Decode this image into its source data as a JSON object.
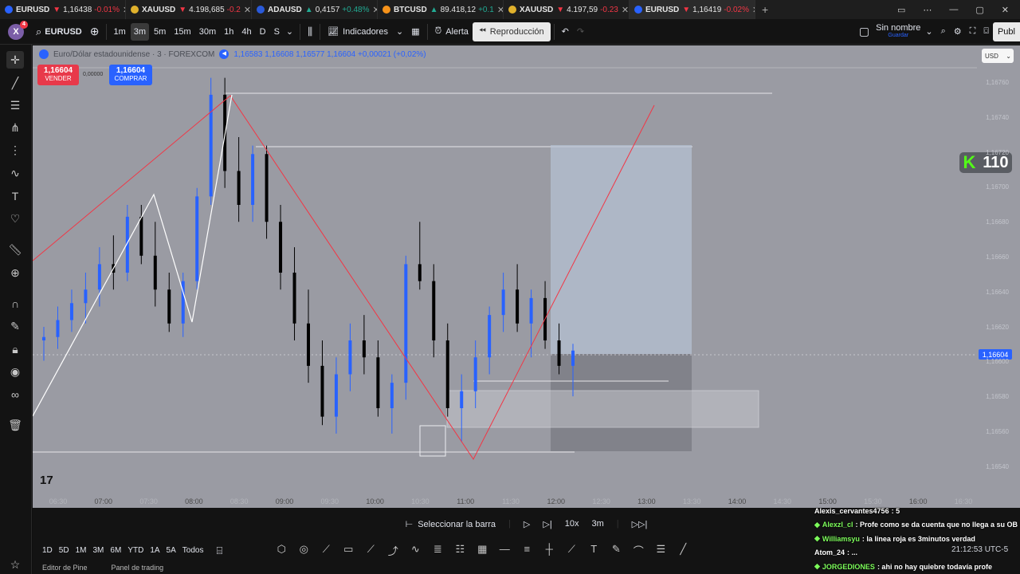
{
  "browser": {
    "tabs": [
      {
        "symbol": "EURUSD",
        "arrow": "▼",
        "price": "1,16438",
        "change": "-0.01%",
        "dir": "down",
        "coin_color": "#2962ff"
      },
      {
        "symbol": "XAUUSD",
        "arrow": "▼",
        "price": "4.198,685",
        "change": "-0.2",
        "dir": "down",
        "coin_color": "#e0b12c"
      },
      {
        "symbol": "ADAUSD",
        "arrow": "▲",
        "price": "0,4157",
        "change": "+0.48%",
        "dir": "up",
        "coin_color": "#2a5ada"
      },
      {
        "symbol": "BTCUSD",
        "arrow": "▲",
        "price": "89.418,12",
        "change": "+0.1",
        "dir": "up",
        "coin_color": "#f7931a"
      },
      {
        "symbol": "XAUUSD",
        "arrow": "▼",
        "price": "4.197,59",
        "change": "-0.23",
        "dir": "down",
        "coin_color": "#e0b12c"
      },
      {
        "symbol": "EURUSD",
        "arrow": "▼",
        "price": "1,16419",
        "change": "-0.02%",
        "dir": "down",
        "coin_color": "#2962ff",
        "active": true
      }
    ],
    "new_tab": "+"
  },
  "toolbar": {
    "logo_letter": "X",
    "logo_badge": "4",
    "symbol": "EURUSD",
    "intervals": [
      "1m",
      "3m",
      "5m",
      "15m",
      "30m",
      "1h",
      "4h",
      "D",
      "S"
    ],
    "active_interval": "3m",
    "indicators": "Indicadores",
    "alert": "Alerta",
    "replay": "Reproducción",
    "layout_name": "Sin nombre",
    "layout_sub": "Guardar",
    "publish": "Publ"
  },
  "chart": {
    "legend_title": "Euro/Dólar estadounidense · 3 · FOREXCOM",
    "ohlc": "1,16583  1,16608  1,16577  1,16604  +0,00021 (+0,02%)",
    "sell_price": "1,16604",
    "sell_label": "VENDER",
    "spread": "0,00000",
    "buy_price": "1,16604",
    "buy_label": "COMPRAR",
    "currency": "USD",
    "kick_count": "110",
    "tv_logo": "17",
    "last_price": "1,16604",
    "y_labels": [
      "1,16760",
      "1,16740",
      "1,16720",
      "1,16700",
      "1,16680",
      "1,16660",
      "1,16640",
      "1,16620",
      "1,16600",
      "1,16580",
      "1,16560",
      "1,16540"
    ],
    "x_labels": [
      "06:30",
      "07:00",
      "07:30",
      "08:00",
      "08:30",
      "09:00",
      "09:30",
      "10:00",
      "10:30",
      "11:00",
      "11:30",
      "12:00",
      "12:30",
      "13:00",
      "13:30",
      "14:00",
      "14:30",
      "15:00",
      "15:30",
      "16:00",
      "16:30"
    ],
    "colors": {
      "bull": "#2962ff",
      "bear": "#000000",
      "zigzag_red": "#f23645",
      "zigzag_white": "#ffffff",
      "background": "#9a9ba3"
    }
  },
  "chart_data": {
    "type": "candlestick",
    "title": "Euro/Dólar estadounidense · 3 · FOREXCOM",
    "xlabel": "",
    "ylabel": "",
    "ylim": [
      1.1653,
      1.1677
    ],
    "note": "approximate candle high/low/open/close values read from the chart",
    "candles": [
      {
        "o": 1.1661,
        "h": 1.16618,
        "l": 1.16598,
        "c": 1.16612
      },
      {
        "o": 1.16612,
        "h": 1.1663,
        "l": 1.16605,
        "c": 1.16622
      },
      {
        "o": 1.16622,
        "h": 1.1664,
        "l": 1.16615,
        "c": 1.16632
      },
      {
        "o": 1.16632,
        "h": 1.1665,
        "l": 1.1662,
        "c": 1.1664
      },
      {
        "o": 1.1664,
        "h": 1.16665,
        "l": 1.1663,
        "c": 1.16655
      },
      {
        "o": 1.16655,
        "h": 1.16672,
        "l": 1.1664,
        "c": 1.1665
      },
      {
        "o": 1.1665,
        "h": 1.1669,
        "l": 1.16645,
        "c": 1.16683
      },
      {
        "o": 1.16683,
        "h": 1.1669,
        "l": 1.16655,
        "c": 1.1666
      },
      {
        "o": 1.1666,
        "h": 1.1668,
        "l": 1.1663,
        "c": 1.1664
      },
      {
        "o": 1.1664,
        "h": 1.1665,
        "l": 1.16615,
        "c": 1.1662
      },
      {
        "o": 1.1662,
        "h": 1.1665,
        "l": 1.16612,
        "c": 1.16645
      },
      {
        "o": 1.16645,
        "h": 1.167,
        "l": 1.1664,
        "c": 1.16695
      },
      {
        "o": 1.16695,
        "h": 1.16765,
        "l": 1.1669,
        "c": 1.16755
      },
      {
        "o": 1.16755,
        "h": 1.16765,
        "l": 1.167,
        "c": 1.1671
      },
      {
        "o": 1.1671,
        "h": 1.1673,
        "l": 1.1668,
        "c": 1.1669
      },
      {
        "o": 1.1669,
        "h": 1.16725,
        "l": 1.1668,
        "c": 1.1672
      },
      {
        "o": 1.1672,
        "h": 1.16725,
        "l": 1.1667,
        "c": 1.1668
      },
      {
        "o": 1.1668,
        "h": 1.1669,
        "l": 1.1664,
        "c": 1.1665
      },
      {
        "o": 1.1665,
        "h": 1.16665,
        "l": 1.1661,
        "c": 1.1662
      },
      {
        "o": 1.1662,
        "h": 1.1664,
        "l": 1.16585,
        "c": 1.16595
      },
      {
        "o": 1.16595,
        "h": 1.1661,
        "l": 1.1656,
        "c": 1.16565
      },
      {
        "o": 1.16565,
        "h": 1.166,
        "l": 1.16555,
        "c": 1.1659
      },
      {
        "o": 1.1659,
        "h": 1.1662,
        "l": 1.1658,
        "c": 1.1661
      },
      {
        "o": 1.1661,
        "h": 1.16625,
        "l": 1.1659,
        "c": 1.166
      },
      {
        "o": 1.166,
        "h": 1.1661,
        "l": 1.16565,
        "c": 1.1657
      },
      {
        "o": 1.1657,
        "h": 1.1659,
        "l": 1.16555,
        "c": 1.16585
      },
      {
        "o": 1.16585,
        "h": 1.1666,
        "l": 1.16575,
        "c": 1.16655
      },
      {
        "o": 1.16655,
        "h": 1.1668,
        "l": 1.1664,
        "c": 1.16645
      },
      {
        "o": 1.16645,
        "h": 1.16655,
        "l": 1.166,
        "c": 1.1661
      },
      {
        "o": 1.1661,
        "h": 1.1662,
        "l": 1.16565,
        "c": 1.1657
      },
      {
        "o": 1.1657,
        "h": 1.1659,
        "l": 1.1655,
        "c": 1.1658
      },
      {
        "o": 1.1658,
        "h": 1.1661,
        "l": 1.1657,
        "c": 1.166
      },
      {
        "o": 1.166,
        "h": 1.1663,
        "l": 1.1659,
        "c": 1.16625
      },
      {
        "o": 1.16625,
        "h": 1.1665,
        "l": 1.16615,
        "c": 1.1664
      },
      {
        "o": 1.1664,
        "h": 1.16655,
        "l": 1.16615,
        "c": 1.1662
      },
      {
        "o": 1.1662,
        "h": 1.1664,
        "l": 1.166,
        "c": 1.16635
      },
      {
        "o": 1.16635,
        "h": 1.16645,
        "l": 1.16605,
        "c": 1.1661
      },
      {
        "o": 1.1661,
        "h": 1.1662,
        "l": 1.1659,
        "c": 1.16595
      },
      {
        "o": 1.16595,
        "h": 1.16608,
        "l": 1.16577,
        "c": 1.16604
      }
    ]
  },
  "replay": {
    "select_bar": "Seleccionar la barra",
    "speed": "10x",
    "interval": "3m"
  },
  "bottom": {
    "ranges": [
      "1D",
      "5D",
      "1M",
      "3M",
      "6M",
      "YTD",
      "1A",
      "5A",
      "Todos"
    ]
  },
  "status": [
    "Editor de Pine",
    "Panel de trading"
  ],
  "chat": {
    "messages": [
      {
        "user": "Alexis_cervantes4756",
        "text": ": 5",
        "gem": false
      },
      {
        "user": "Alexzl_cl",
        "text": ": Profe como se da cuenta que no llega a su OB",
        "gem": true
      },
      {
        "user": "Williamsyu",
        "text": ": la linea roja es 3minutos verdad",
        "gem": true
      },
      {
        "user": "Atom_24",
        "text": ": ...",
        "gem": false
      },
      {
        "user": "JORGEDIONES",
        "text": ": ahi no hay quiebre todavía profe",
        "gem": true
      }
    ],
    "clock": "21:12:53 UTC-5"
  }
}
